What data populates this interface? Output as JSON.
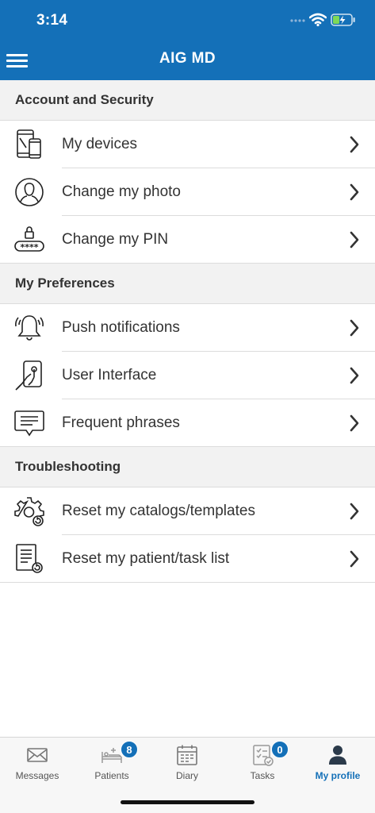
{
  "status_bar": {
    "time": "3:14"
  },
  "header": {
    "title": "AIG MD"
  },
  "sections": [
    {
      "title": "Account and Security",
      "items": [
        {
          "label": "My devices",
          "icon": "devices-icon"
        },
        {
          "label": "Change my photo",
          "icon": "user-photo-icon"
        },
        {
          "label": "Change my PIN",
          "icon": "pin-lock-icon",
          "pin_text": "****"
        }
      ]
    },
    {
      "title": "My Preferences",
      "items": [
        {
          "label": "Push notifications",
          "icon": "bell-icon"
        },
        {
          "label": "User Interface",
          "icon": "touch-phone-icon"
        },
        {
          "label": "Frequent phrases",
          "icon": "speech-bubble-icon"
        }
      ]
    },
    {
      "title": "Troubleshooting",
      "items": [
        {
          "label": "Reset my catalogs/templates",
          "icon": "gear-reset-icon"
        },
        {
          "label": "Reset my patient/task list",
          "icon": "document-reset-icon"
        }
      ]
    }
  ],
  "tabbar": {
    "tabs": [
      {
        "label": "Messages",
        "icon": "envelope-icon"
      },
      {
        "label": "Patients",
        "icon": "bed-icon",
        "badge": "8"
      },
      {
        "label": "Diary",
        "icon": "calendar-icon"
      },
      {
        "label": "Tasks",
        "icon": "checklist-icon",
        "badge": "0"
      },
      {
        "label": "My profile",
        "icon": "person-icon",
        "active": true
      }
    ]
  },
  "colors": {
    "brand": "#1470b8",
    "section_bg": "#f2f2f2",
    "text": "#333333"
  }
}
